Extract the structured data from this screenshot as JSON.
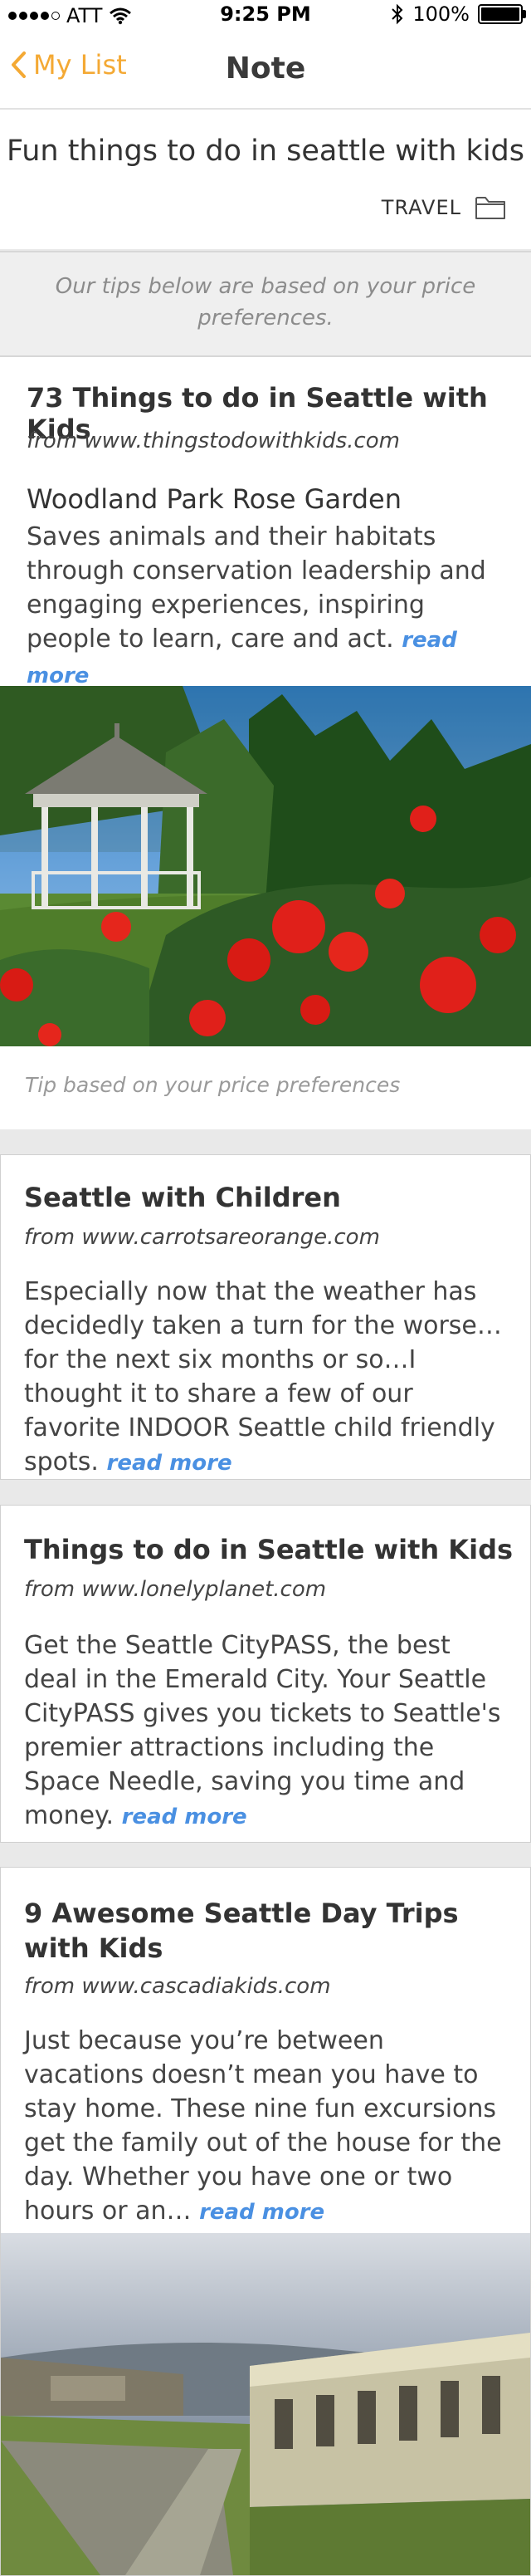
{
  "statusbar": {
    "carrier": "ATT",
    "time": "9:25 PM",
    "battery": "100%"
  },
  "nav": {
    "back_label": "My List",
    "title": "Note"
  },
  "note": {
    "title": "Fun things to do in seattle with kids",
    "tag": "TRAVEL"
  },
  "tips_banner": "Our tips below are based on your price preferences.",
  "cards": [
    {
      "title": "73 Things to do in Seattle with Kids",
      "source": "from www.thingstodowithkids.com",
      "subtitle": "Woodland Park Rose Garden",
      "description": "Saves animals and their habitats through conservation leadership and engaging experiences, inspiring people to learn, care and act.",
      "read_more": "read more",
      "tip_note": "Tip based on your price preferences"
    },
    {
      "title": "Seattle with Children",
      "source": "from www.carrotsareorange.com",
      "description": "Especially now that the weather has decidedly taken a turn for the worse…for the next six months or so…I thought it to share a few of our favorite INDOOR Seattle child friendly spots.",
      "read_more": "read more"
    },
    {
      "title": "Things to do in Seattle with Kids",
      "source": "from www.lonelyplanet.com",
      "description": "Get the Seattle CityPASS, the best deal in the Emerald City. Your Seattle CityPASS gives you tickets to Seattle's premier attractions including the Space Needle, saving you time and money.",
      "read_more": "read more"
    },
    {
      "title": "9 Awesome Seattle Day Trips with Kids",
      "source": "from www.cascadiakids.com",
      "description": "Just because you’re between vacations doesn’t mean you have to stay home. These nine fun excursions get the family out of the house for the day. Whether you have one or two hours or an…",
      "read_more": "read more"
    }
  ],
  "colors": {
    "accent": "#f4a934",
    "link": "#4a90e2"
  },
  "icons": {
    "back": "chevron-left-icon",
    "folder": "folder-icon",
    "wifi": "wifi-icon",
    "bluetooth": "bluetooth-icon",
    "battery": "battery-icon"
  }
}
